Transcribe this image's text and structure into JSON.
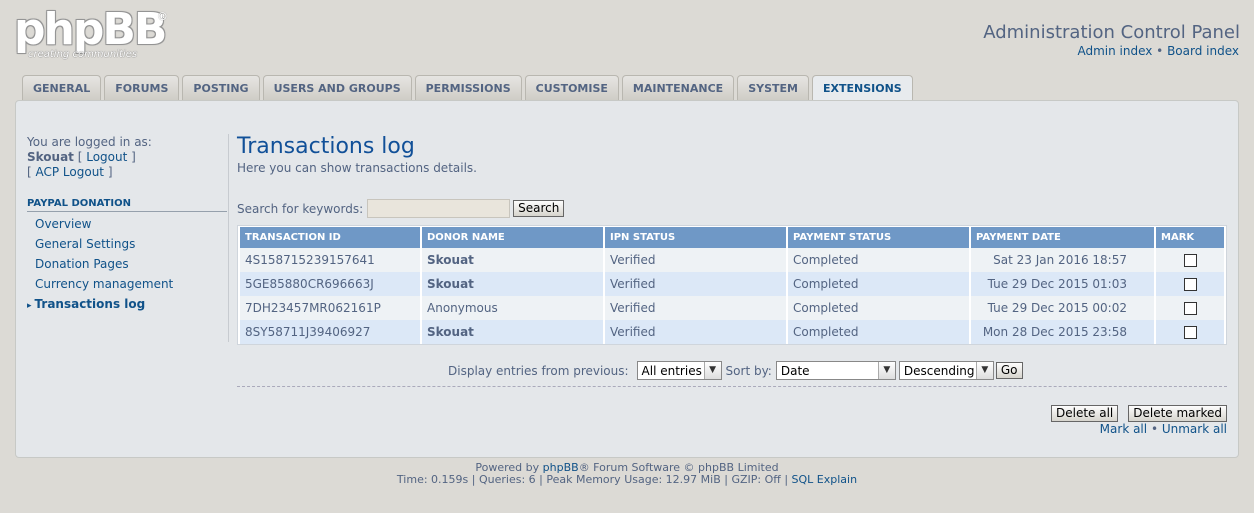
{
  "logo": {
    "text": "phpBB",
    "reg": "®",
    "tagline": "creating communities"
  },
  "header": {
    "title": "Administration Control Panel",
    "admin_index": "Admin index",
    "separator": "•",
    "board_index": "Board index"
  },
  "tabs": [
    {
      "label": "GENERAL",
      "active": false
    },
    {
      "label": "FORUMS",
      "active": false
    },
    {
      "label": "POSTING",
      "active": false
    },
    {
      "label": "USERS AND GROUPS",
      "active": false
    },
    {
      "label": "PERMISSIONS",
      "active": false
    },
    {
      "label": "CUSTOMISE",
      "active": false
    },
    {
      "label": "MAINTENANCE",
      "active": false
    },
    {
      "label": "SYSTEM",
      "active": false
    },
    {
      "label": "EXTENSIONS",
      "active": true
    }
  ],
  "sidebar": {
    "logged_in_as": "You are logged in as:",
    "username": "Skouat",
    "logout": "Logout",
    "acp_logout": "ACP Logout",
    "section_title": "PAYPAL DONATION",
    "items": [
      {
        "label": "Overview",
        "active": false
      },
      {
        "label": "General Settings",
        "active": false
      },
      {
        "label": "Donation Pages",
        "active": false
      },
      {
        "label": "Currency management",
        "active": false
      },
      {
        "label": "Transactions log",
        "active": true
      }
    ]
  },
  "main": {
    "title": "Transactions log",
    "description": "Here you can show transactions details.",
    "search_label": "Search for keywords:",
    "search_value": "",
    "search_button": "Search"
  },
  "table": {
    "headers": [
      "TRANSACTION ID",
      "DONOR NAME",
      "IPN STATUS",
      "PAYMENT STATUS",
      "PAYMENT DATE",
      "MARK"
    ],
    "rows": [
      {
        "id": "4S158715239157641",
        "donor": "Skouat",
        "donor_bold": true,
        "ipn": "Verified",
        "payment": "Completed",
        "date": "Sat 23 Jan 2016 18:57"
      },
      {
        "id": "5GE85880CR696663J",
        "donor": "Skouat",
        "donor_bold": true,
        "ipn": "Verified",
        "payment": "Completed",
        "date": "Tue 29 Dec 2015 01:03"
      },
      {
        "id": "7DH23457MR062161P",
        "donor": "Anonymous",
        "donor_bold": false,
        "ipn": "Verified",
        "payment": "Completed",
        "date": "Tue 29 Dec 2015 00:02"
      },
      {
        "id": "8SY58711J39406927",
        "donor": "Skouat",
        "donor_bold": true,
        "ipn": "Verified",
        "payment": "Completed",
        "date": "Mon 28 Dec 2015 23:58"
      }
    ]
  },
  "filters": {
    "display_label": "Display entries from previous:",
    "display_value": "All entries",
    "sort_label": "Sort by:",
    "sort_value": "Date",
    "order_value": "Descending",
    "go_button": "Go"
  },
  "actions": {
    "delete_all": "Delete all",
    "delete_marked": "Delete marked",
    "mark_all": "Mark all",
    "unmark_all": "Unmark all",
    "separator": "•"
  },
  "footer": {
    "powered_prefix": "Powered by",
    "phpbb_link": "phpBB",
    "powered_suffix": "® Forum Software © phpBB Limited",
    "stats": "Time: 0.159s | Queries: 6 | Peak Memory Usage: 12.97 MiB | GZIP: Off |",
    "sql_explain": "SQL Explain"
  },
  "colors": {
    "accent": "#105289",
    "table_header": "#6f98c6",
    "donor_highlight": "#aa0000"
  }
}
